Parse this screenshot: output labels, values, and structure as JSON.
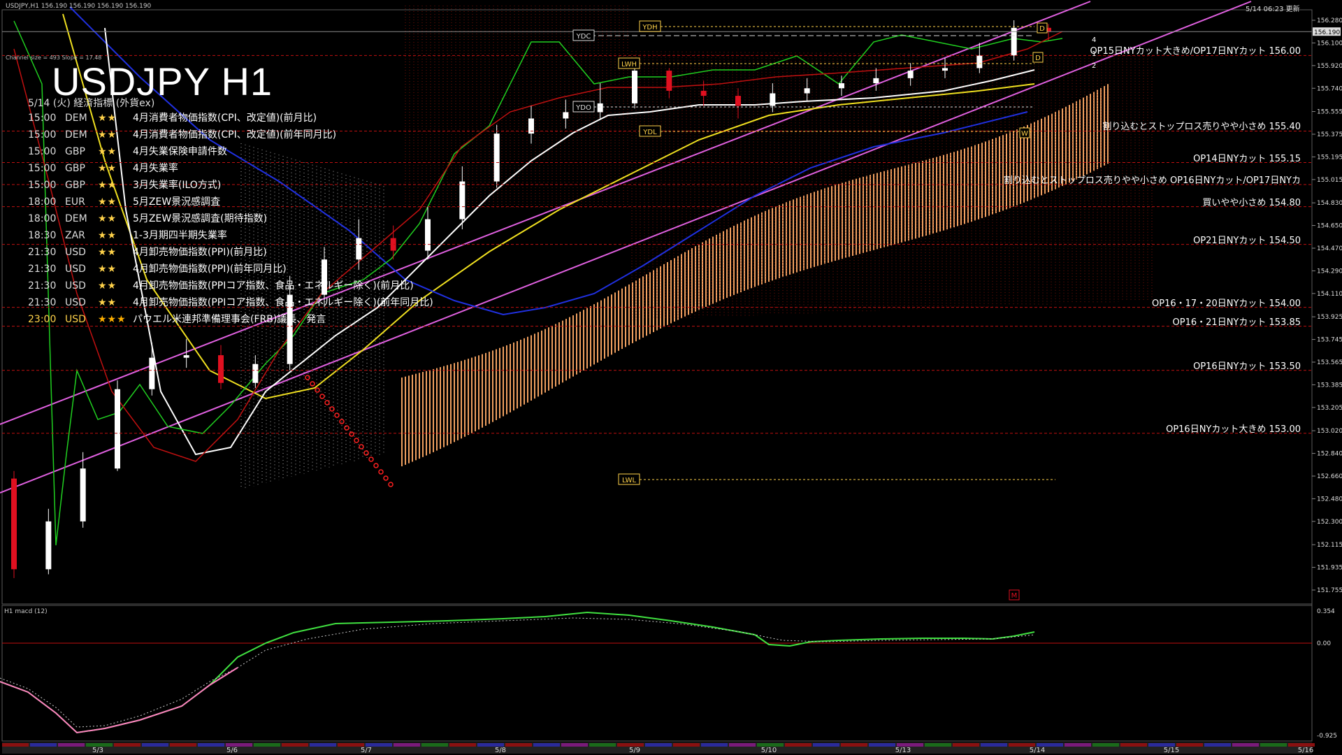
{
  "header": {
    "title": "USDJPY H1",
    "subtitle": "5/14 (火) 経済指標 (外貨ex)",
    "symbol_line": "USDJPY,H1 156.190 156.190 156.190 156.190",
    "updated": "5/14 06:23 更新",
    "channel_info": "Channel size = 493 Slope = 17.48"
  },
  "events": [
    {
      "time": "15:00",
      "cur": "DEM",
      "stars": "★★",
      "name": "4月消費者物価指数(CPI、改定値)(前月比)",
      "hi": false
    },
    {
      "time": "15:00",
      "cur": "DEM",
      "stars": "★★",
      "name": "4月消費者物価指数(CPI、改定値)(前年同月比)",
      "hi": false
    },
    {
      "time": "15:00",
      "cur": "GBP",
      "stars": "★★",
      "name": "4月失業保険申請件数",
      "hi": false
    },
    {
      "time": "15:00",
      "cur": "GBP",
      "stars": "★★",
      "name": "4月失業率",
      "hi": false
    },
    {
      "time": "15:00",
      "cur": "GBP",
      "stars": "★★",
      "name": "3月失業率(ILO方式)",
      "hi": false
    },
    {
      "time": "18:00",
      "cur": "EUR",
      "stars": "★★",
      "name": "5月ZEW景況感調査",
      "hi": false
    },
    {
      "time": "18:00",
      "cur": "DEM",
      "stars": "★★",
      "name": "5月ZEW景況感調査(期待指数)",
      "hi": false
    },
    {
      "time": "18:30",
      "cur": "ZAR",
      "stars": "★★",
      "name": "1-3月期四半期失業率",
      "hi": false
    },
    {
      "time": "21:30",
      "cur": "USD",
      "stars": "★★",
      "name": "4月卸売物価指数(PPI)(前月比)",
      "hi": false
    },
    {
      "time": "21:30",
      "cur": "USD",
      "stars": "★★",
      "name": "4月卸売物価指数(PPI)(前年同月比)",
      "hi": false
    },
    {
      "time": "21:30",
      "cur": "USD",
      "stars": "★★",
      "name": "4月卸売物価指数(PPIコア指数、食品・エネルギー除く)(前月比)",
      "hi": false
    },
    {
      "time": "21:30",
      "cur": "USD",
      "stars": "★★",
      "name": "4月卸売物価指数(PPIコア指数、食品・エネルギー除く)(前年同月比)",
      "hi": false
    },
    {
      "time": "23:00",
      "cur": "USD",
      "stars": "★★★",
      "name": "パウエル米連邦準備理事会(FRB)議長、発言",
      "hi": true
    }
  ],
  "annotations": [
    {
      "text": "OP15日NYカット大きめ/OP17日NYカット 156.00",
      "price": 156.0
    },
    {
      "text": "割り込むとストップロス売りやや小さめ 155.40",
      "price": 155.4
    },
    {
      "text": "OP14日NYカット 155.15",
      "price": 155.15
    },
    {
      "text": "買いやや小さめ 154.80",
      "price": 154.8
    },
    {
      "text": "OP21日NYカット 154.50",
      "price": 154.5
    },
    {
      "text": "OP16・17・20日NYカット 154.00",
      "price": 154.0
    },
    {
      "text": "OP16・21日NYカット 153.85",
      "price": 153.85
    },
    {
      "text": "OP16日NYカット 153.50",
      "price": 153.5
    },
    {
      "text": "OP16日NYカット大きめ 153.00",
      "price": 153.0
    },
    {
      "text": "割り込むとストップロス売りやや小さめ OP16日NYカット/OP17日NYカ",
      "price": 154.975
    }
  ],
  "markers": {
    "ydc": "YDC",
    "ydh": "YDH",
    "ydo": "YDO",
    "ydl": "YDL",
    "lwh": "LWH",
    "lwl": "LWL",
    "d": "D",
    "w": "W",
    "m": "M",
    "num4": "4",
    "num1": "1",
    "num2": "2"
  },
  "macd_label": "H1 macd (12)",
  "colors": {
    "bull": "#ffffff",
    "bear": "#e01020",
    "cloud": "#f0a060",
    "channel": "#e060e0",
    "ma_fast": "#ffffff",
    "ma_mid": "#f0e020",
    "ma_slow": "#2030e0",
    "tenkan": "#20d020",
    "level_dash": "#c01010",
    "sar": "#ff2020",
    "macd_line": "#40e040",
    "macd_pink": "#ff80c0"
  },
  "chart_data": {
    "type": "candlestick",
    "symbol": "USDJPY",
    "timeframe": "H1",
    "price_axis": {
      "min": 151.755,
      "max": 156.28,
      "ticks": [
        "156.280",
        "156.100",
        "155.920",
        "155.740",
        "155.555",
        "155.375",
        "155.195",
        "155.015",
        "154.830",
        "154.650",
        "154.470",
        "154.290",
        "154.110",
        "153.925",
        "153.745",
        "153.565",
        "153.385",
        "153.205",
        "153.020",
        "152.840",
        "152.660",
        "152.480",
        "152.300",
        "152.115",
        "151.935",
        "151.755"
      ]
    },
    "current_price": "156.190",
    "date_labels": [
      "5/3",
      "5/6",
      "5/7",
      "5/8",
      "5/9",
      "5/10",
      "5/13",
      "5/14",
      "5/15",
      "5/16"
    ],
    "macd": {
      "ticks": [
        "0.354",
        "0.00",
        "-0.925"
      ]
    },
    "open_price": [
      152.64,
      151.92,
      152.3,
      152.72,
      153.35,
      153.6,
      153.62,
      153.4,
      153.55,
      154.1,
      154.38,
      154.55,
      154.45,
      154.7,
      155.0,
      155.38,
      155.5,
      155.55,
      155.62,
      155.88,
      155.72,
      155.68,
      155.6,
      155.7,
      155.74,
      155.78,
      155.82,
      155.88,
      155.9,
      156.0,
      156.22
    ],
    "close_price": [
      151.92,
      152.3,
      152.72,
      153.35,
      153.6,
      153.62,
      153.4,
      153.55,
      154.1,
      154.38,
      154.55,
      154.45,
      154.7,
      155.0,
      155.38,
      155.5,
      155.55,
      155.62,
      155.88,
      155.72,
      155.68,
      155.6,
      155.7,
      155.74,
      155.78,
      155.82,
      155.88,
      155.9,
      156.0,
      156.22,
      156.19
    ],
    "high_price": [
      152.7,
      152.4,
      152.85,
      153.42,
      153.72,
      153.75,
      153.7,
      153.62,
      154.25,
      154.48,
      154.7,
      154.65,
      154.8,
      155.12,
      155.45,
      155.6,
      155.65,
      155.78,
      155.95,
      155.9,
      155.8,
      155.74,
      155.78,
      155.82,
      155.84,
      155.9,
      155.94,
      155.98,
      156.1,
      156.28,
      156.25
    ],
    "low_price": [
      151.85,
      151.88,
      152.25,
      152.7,
      153.3,
      153.52,
      153.35,
      153.36,
      153.5,
      154.0,
      154.3,
      154.38,
      154.38,
      154.62,
      154.95,
      155.3,
      155.42,
      155.5,
      155.58,
      155.66,
      155.6,
      155.5,
      155.55,
      155.64,
      155.68,
      155.72,
      155.76,
      155.82,
      155.86,
      155.96,
      156.12
    ]
  }
}
